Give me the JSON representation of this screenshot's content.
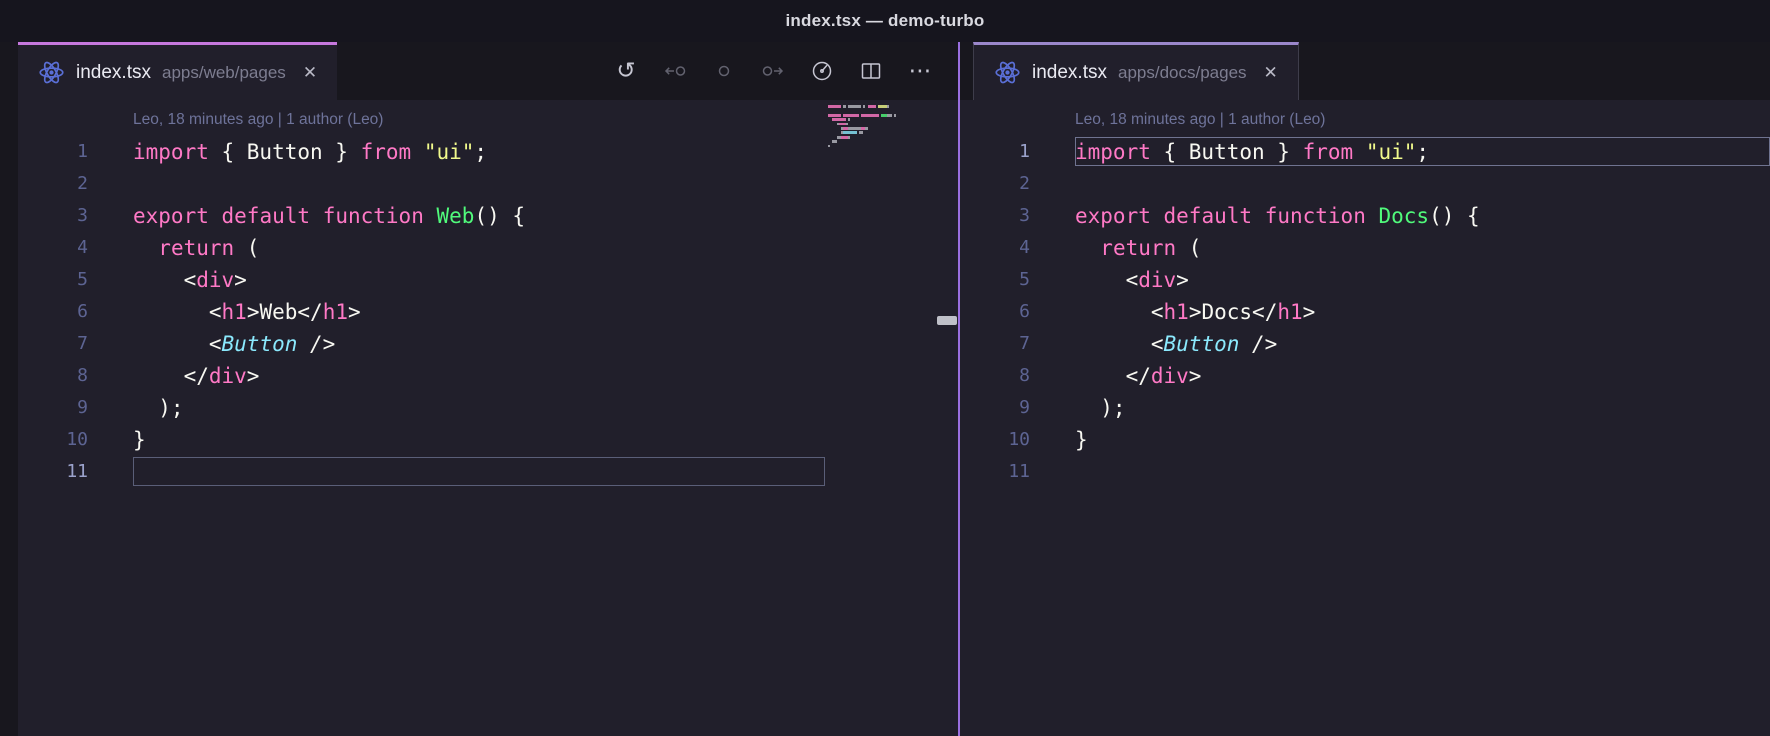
{
  "window": {
    "title": "index.tsx — demo-turbo"
  },
  "colors": {
    "titlebar_bg": "#16151e",
    "tabbar_bg": "#18171e",
    "editor_bg": "#211f2b",
    "rail_bg": "#18171e",
    "tab_accent_left": "#c678dd",
    "tab_accent_right": "#9b87cb",
    "divider": "#9a6fe0",
    "foreground": "#f8f8f2",
    "keyword": "#ff79c6",
    "string": "#f1fa8c",
    "function_name": "#50fa7b",
    "tag": "#ff79c6",
    "component": "#8be9fd",
    "line_number": "#5d6493",
    "blame": "#6e739a",
    "react_icon": "#5a6fd6",
    "title_fg": "#d9d9e0",
    "tab_fg": "#eaeaf2",
    "tab_path_fg": "#7d7d90",
    "icon_fg": "#c6c6d2",
    "icon_dim": "#62626f",
    "cur_line_border": "#5a5e78",
    "sash": "#bfc0c8"
  },
  "icons": {
    "close": "✕",
    "history": "↺",
    "more": "⋯"
  },
  "toolbar": {
    "icons": [
      "history-icon",
      "previous-change-icon",
      "current-change-icon",
      "next-change-icon",
      "gitlens-icon",
      "split-editor-icon",
      "more-actions-icon"
    ]
  },
  "panes": [
    {
      "tab": {
        "filename": "index.tsx",
        "path": "apps/web/pages"
      },
      "blame": "Leo, 18 minutes ago | 1 author (Leo)",
      "active_line": 11,
      "code": [
        {
          "n": 1,
          "tokens": [
            [
              "import",
              "k"
            ],
            [
              " { Button } ",
              "p"
            ],
            [
              "from",
              "k"
            ],
            [
              " ",
              "p"
            ],
            [
              "\"ui\"",
              "s"
            ],
            [
              ";",
              "p"
            ]
          ]
        },
        {
          "n": 2,
          "tokens": []
        },
        {
          "n": 3,
          "tokens": [
            [
              "export",
              "k"
            ],
            [
              " ",
              "p"
            ],
            [
              "default",
              "k"
            ],
            [
              " ",
              "p"
            ],
            [
              "function",
              "k"
            ],
            [
              " ",
              "p"
            ],
            [
              "Web",
              "f"
            ],
            [
              "() {",
              "p"
            ]
          ]
        },
        {
          "n": 4,
          "tokens": [
            [
              "  ",
              "p"
            ],
            [
              "return",
              "k"
            ],
            [
              " (",
              "p"
            ]
          ]
        },
        {
          "n": 5,
          "tokens": [
            [
              "    <",
              "p"
            ],
            [
              "div",
              "t"
            ],
            [
              ">",
              "p"
            ]
          ]
        },
        {
          "n": 6,
          "tokens": [
            [
              "      <",
              "p"
            ],
            [
              "h1",
              "t"
            ],
            [
              ">",
              "p"
            ],
            [
              "Web",
              "p"
            ],
            [
              "</",
              "p"
            ],
            [
              "h1",
              "t"
            ],
            [
              ">",
              "p"
            ]
          ]
        },
        {
          "n": 7,
          "tokens": [
            [
              "      ",
              "p"
            ],
            [
              "<",
              "pi"
            ],
            [
              "Button",
              "c"
            ],
            [
              " />",
              "pi"
            ]
          ]
        },
        {
          "n": 8,
          "tokens": [
            [
              "    </",
              "p"
            ],
            [
              "div",
              "t"
            ],
            [
              ">",
              "p"
            ]
          ]
        },
        {
          "n": 9,
          "tokens": [
            [
              "  );",
              "p"
            ]
          ]
        },
        {
          "n": 10,
          "tokens": [
            [
              "}",
              "p"
            ]
          ]
        },
        {
          "n": 11,
          "tokens": []
        }
      ]
    },
    {
      "tab": {
        "filename": "index.tsx",
        "path": "apps/docs/pages"
      },
      "blame": "Leo, 18 minutes ago | 1 author (Leo)",
      "active_line": 1,
      "code": [
        {
          "n": 1,
          "tokens": [
            [
              "import",
              "k"
            ],
            [
              " { Button } ",
              "p"
            ],
            [
              "from",
              "k"
            ],
            [
              " ",
              "p"
            ],
            [
              "\"ui\"",
              "s"
            ],
            [
              ";",
              "p"
            ]
          ]
        },
        {
          "n": 2,
          "tokens": []
        },
        {
          "n": 3,
          "tokens": [
            [
              "export",
              "k"
            ],
            [
              " ",
              "p"
            ],
            [
              "default",
              "k"
            ],
            [
              " ",
              "p"
            ],
            [
              "function",
              "k"
            ],
            [
              " ",
              "p"
            ],
            [
              "Docs",
              "f"
            ],
            [
              "() {",
              "p"
            ]
          ]
        },
        {
          "n": 4,
          "tokens": [
            [
              "  ",
              "p"
            ],
            [
              "return",
              "k"
            ],
            [
              " (",
              "p"
            ]
          ]
        },
        {
          "n": 5,
          "tokens": [
            [
              "    <",
              "p"
            ],
            [
              "div",
              "t"
            ],
            [
              ">",
              "p"
            ]
          ]
        },
        {
          "n": 6,
          "tokens": [
            [
              "      <",
              "p"
            ],
            [
              "h1",
              "t"
            ],
            [
              ">",
              "p"
            ],
            [
              "Docs",
              "p"
            ],
            [
              "</",
              "p"
            ],
            [
              "h1",
              "t"
            ],
            [
              ">",
              "p"
            ]
          ]
        },
        {
          "n": 7,
          "tokens": [
            [
              "      ",
              "p"
            ],
            [
              "<",
              "pi"
            ],
            [
              "Button",
              "c"
            ],
            [
              " />",
              "pi"
            ]
          ]
        },
        {
          "n": 8,
          "tokens": [
            [
              "    </",
              "p"
            ],
            [
              "div",
              "t"
            ],
            [
              ">",
              "p"
            ]
          ]
        },
        {
          "n": 9,
          "tokens": [
            [
              "  );",
              "p"
            ]
          ]
        },
        {
          "n": 10,
          "tokens": [
            [
              "}",
              "p"
            ]
          ]
        },
        {
          "n": 11,
          "tokens": []
        }
      ]
    }
  ]
}
